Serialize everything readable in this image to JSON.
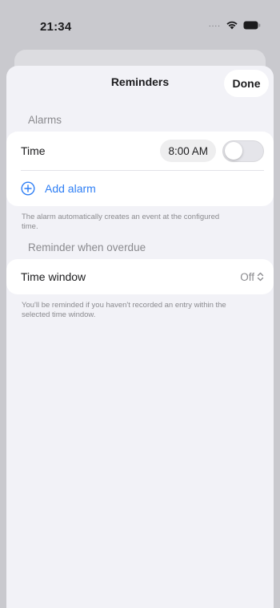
{
  "status_bar": {
    "time": "21:34",
    "signal": "....",
    "wifi_icon": "wifi-icon",
    "battery_icon": "battery-icon"
  },
  "nav": {
    "title": "Reminders",
    "done_label": "Done"
  },
  "alarms": {
    "header": "Alarms",
    "time_label": "Time",
    "time_value": "8:00 AM",
    "toggle_on": false,
    "add_label": "Add alarm",
    "add_icon": "plus-circle-icon",
    "footnote": "The alarm automatically creates an event at the configured time."
  },
  "overdue": {
    "header": "Reminder when overdue",
    "window_label": "Time window",
    "window_value": "Off",
    "window_icon": "chevron-up-down-icon",
    "footnote": "You'll be reminded if you haven't recorded an entry within the selected time window."
  },
  "colors": {
    "accent": "#2f7ff5",
    "background": "#f2f2f7",
    "secondary_text": "#8a8a8e"
  }
}
